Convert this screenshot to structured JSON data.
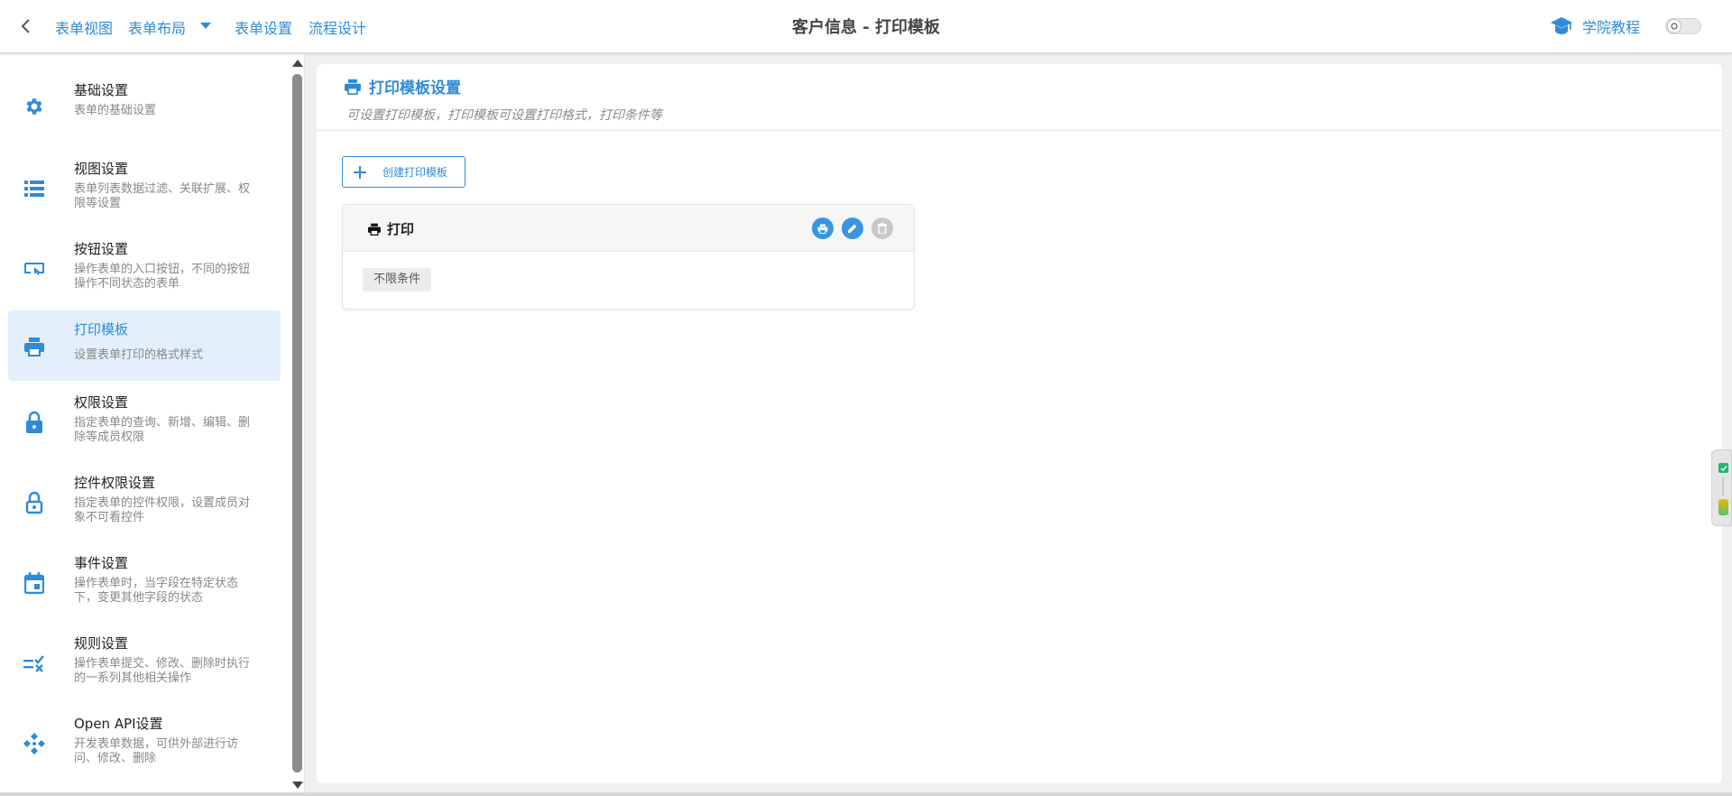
{
  "topbar": {
    "back_icon": "chevron-left-icon",
    "links": {
      "form_view": "表单视图",
      "form_layout": "表单布局",
      "form_settings": "表单设置",
      "flow_design": "流程设计"
    },
    "title": "客户信息 - 打印模板",
    "academy_label": "学院教程",
    "academy_icon": "graduation-cap-icon",
    "theme_icon": "sun-icon"
  },
  "sidebar": {
    "items": [
      {
        "title": "基础设置",
        "desc": "表单的基础设置",
        "icon": "gear-icon"
      },
      {
        "title": "视图设置",
        "desc": "表单列表数据过滤、关联扩展、权限等设置",
        "icon": "list-icon"
      },
      {
        "title": "按钮设置",
        "desc": "操作表单的入口按钮，不同的按钮操作不同状态的表单",
        "icon": "button-icon"
      },
      {
        "title": "打印模板",
        "desc": "设置表单打印的格式样式",
        "icon": "printer-icon",
        "active": true
      },
      {
        "title": "权限设置",
        "desc": "指定表单的查询、新增、编辑、删除等成员权限",
        "icon": "lock-icon"
      },
      {
        "title": "控件权限设置",
        "desc": "指定表单的控件权限，设置成员对象不可看控件",
        "icon": "lock-open-icon"
      },
      {
        "title": "事件设置",
        "desc": "操作表单时，当字段在特定状态下，变更其他字段的状态",
        "icon": "calendar-icon"
      },
      {
        "title": "规则设置",
        "desc": "操作表单提交、修改、删除时执行的一系列其他相关操作",
        "icon": "rule-check-icon"
      },
      {
        "title": "Open API设置",
        "desc": "开发表单数据，可供外部进行访问、修改、删除",
        "icon": "api-icon"
      }
    ]
  },
  "main": {
    "title": "打印模板设置",
    "title_icon": "printer-icon",
    "subtitle": "可设置打印模板，打印模板可设置打印格式，打印条件等",
    "create_button": "创建打印模板",
    "templates": [
      {
        "name": "打印",
        "condition": "不限条件",
        "actions": [
          "print-icon",
          "edit-icon",
          "delete-icon"
        ]
      }
    ]
  },
  "colors": {
    "accent": "#2f8bd8",
    "active_bg": "#e3f0fb",
    "action_blue": "#3a96e4",
    "action_gray": "#c9c9c9"
  }
}
